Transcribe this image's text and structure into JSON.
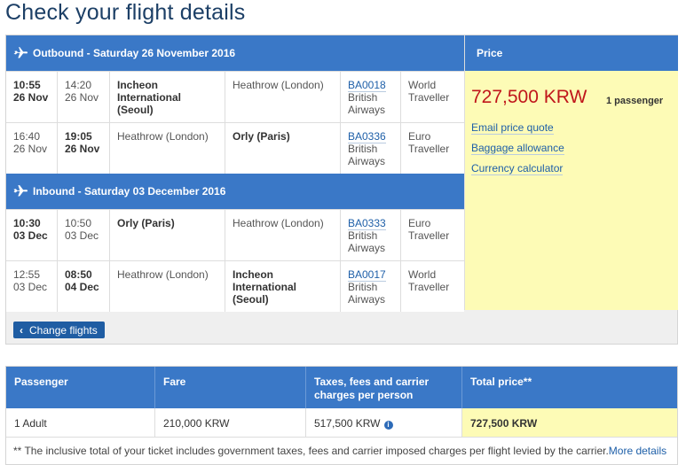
{
  "page": {
    "title": "Check your flight details"
  },
  "outbound": {
    "header": "Outbound - Saturday 26 November 2016",
    "flights": [
      {
        "dep_time": "10:55",
        "dep_date": "26 Nov",
        "arr_time": "14:20",
        "arr_date": "26 Nov",
        "from": "Incheon International (Seoul)",
        "to": "Heathrow (London)",
        "flight_no": "BA0018",
        "airline": "British Airways",
        "cabin": "World Traveller"
      },
      {
        "dep_time": "16:40",
        "dep_date": "26 Nov",
        "arr_time": "19:05",
        "arr_date": "26 Nov",
        "from": "Heathrow (London)",
        "to": "Orly (Paris)",
        "flight_no": "BA0336",
        "airline": "British Airways",
        "cabin": "Euro Traveller"
      }
    ]
  },
  "inbound": {
    "header": "Inbound - Saturday 03 December 2016",
    "flights": [
      {
        "dep_time": "10:30",
        "dep_date": "03 Dec",
        "arr_time": "10:50",
        "arr_date": "03 Dec",
        "from": "Orly (Paris)",
        "to": "Heathrow (London)",
        "flight_no": "BA0333",
        "airline": "British Airways",
        "cabin": "Euro Traveller"
      },
      {
        "dep_time": "12:55",
        "dep_date": "03 Dec",
        "arr_time": "08:50",
        "arr_date": "04 Dec",
        "from": "Heathrow (London)",
        "to": "Incheon International (Seoul)",
        "flight_no": "BA0017",
        "airline": "British Airways",
        "cabin": "World Traveller"
      }
    ]
  },
  "price": {
    "header": "Price",
    "amount": "727,500 KRW",
    "passengers": "1 passenger",
    "links": [
      "Email price quote",
      "Baggage allowance",
      "Currency calculator"
    ]
  },
  "change_flights_label": "Change flights",
  "summary": {
    "headers": [
      "Passenger",
      "Fare",
      "Taxes, fees and carrier charges per person",
      "Total price**"
    ],
    "row": [
      "1 Adult",
      "210,000 KRW",
      "517,500 KRW",
      "727,500 KRW"
    ],
    "note": "** The inclusive total of your ticket includes government taxes, fees and carrier imposed charges per flight levied by the carrier.",
    "more_details": "More details"
  },
  "colors": {
    "header_blue": "#3a78c7",
    "price_bg": "#fdfbb6",
    "price_red": "#c0161b",
    "link": "#1e5fa8"
  }
}
